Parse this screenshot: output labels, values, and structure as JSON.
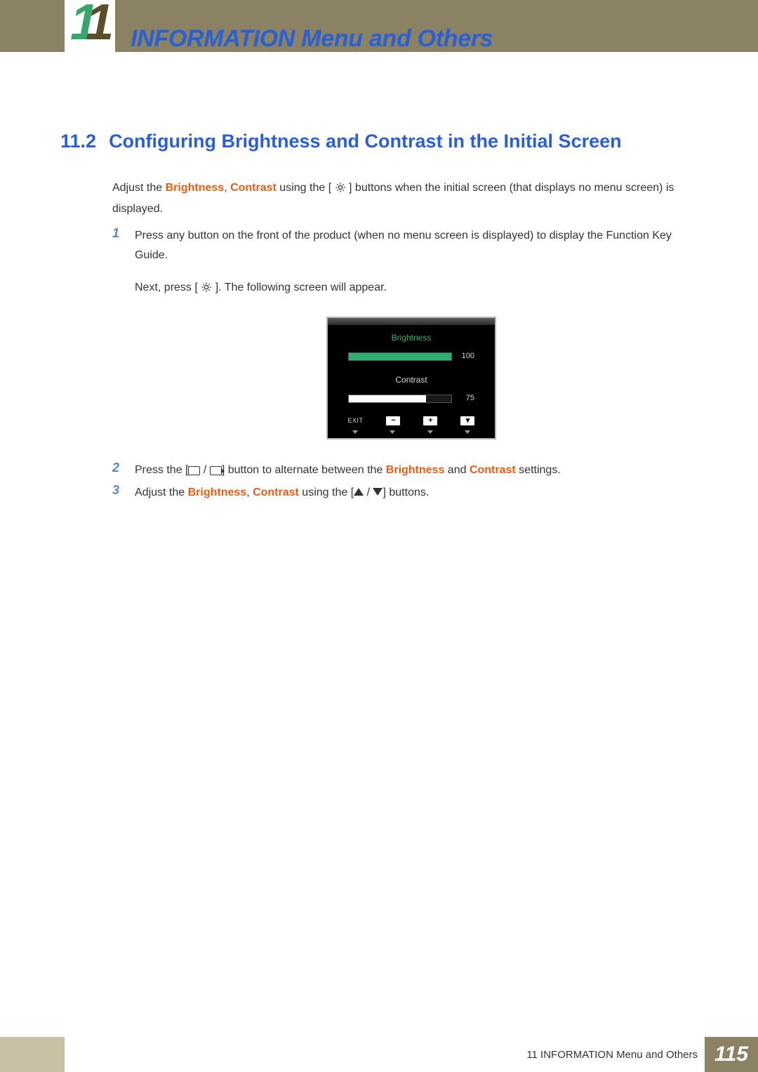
{
  "header": {
    "title": "INFORMATION Menu and Others"
  },
  "section": {
    "number": "11.2",
    "title": "Configuring Brightness and Contrast in the Initial Screen"
  },
  "intro": {
    "prefix": "Adjust the ",
    "hl1": "Brightness",
    "sep": ", ",
    "hl2": "Contrast",
    "mid": " using the [ ",
    "mid2": " ] buttons when the initial screen (that displays no menu screen) is displayed."
  },
  "steps": [
    {
      "num": "1",
      "text1": "Press any button on the front of the product (when no menu screen is displayed) to display the Function Key Guide.",
      "text2a": "Next, press [ ",
      "text2b": " ]. The following screen will appear."
    },
    {
      "num": "2",
      "pre": "Press the [",
      "mid": "] button to alternate between the ",
      "hl1": "Brightness",
      "and": " and ",
      "hl2": "Contrast",
      "post": " settings."
    },
    {
      "num": "3",
      "pre": "Adjust the ",
      "hl1": "Brightness",
      "sep": ", ",
      "hl2": "Contrast",
      "mid": " using the [",
      "post": "] buttons."
    }
  ],
  "osd": {
    "brightness_label": "Brightness",
    "brightness_value": "100",
    "contrast_label": "Contrast",
    "contrast_value": "75",
    "exit": "EXIT",
    "minus": "−",
    "plus": "+"
  },
  "footer": {
    "chapter": "11 INFORMATION Menu and Others",
    "page": "115"
  }
}
